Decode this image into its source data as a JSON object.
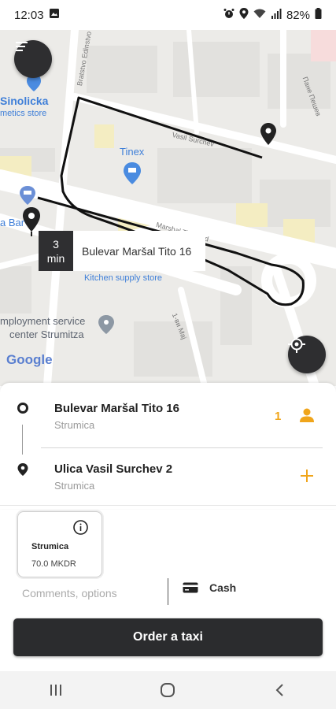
{
  "status": {
    "time": "12:03",
    "battery": "82%"
  },
  "map": {
    "labels": {
      "sinolicka": "Sinolicka",
      "cosmetics": "metics store",
      "tinex": "Tinex",
      "bar": "a Bar",
      "employment_line1": "mployment service",
      "employment_line2": "center Strumitza",
      "kitchen": "Kitchen supply store",
      "google": "Google",
      "street_marshal": "Marshal Tito Blvd",
      "street_surchev": "Vasil Surchev",
      "street_bratstvo": "Bratstvo Edinstvo",
      "street_pane": "Пане Пешев",
      "street_1may": "1-ви Мај"
    },
    "eta": {
      "value": "3",
      "unit": "min"
    },
    "eta_address": "Bulevar Maršal Tito 16"
  },
  "route": {
    "pickup": {
      "title": "Bulevar Maršal Tito 16",
      "city": "Strumica",
      "passengers": "1"
    },
    "dropoff": {
      "title": "Ulica Vasil Surchev 2",
      "city": "Strumica"
    }
  },
  "tariff": {
    "name": "Strumica",
    "price": "70.0 MKDR"
  },
  "comments_placeholder": "Comments, options",
  "payment": "Cash",
  "order_label": "Order a taxi",
  "colors": {
    "accent": "#f0a51b",
    "dark": "#2b2c2e"
  }
}
